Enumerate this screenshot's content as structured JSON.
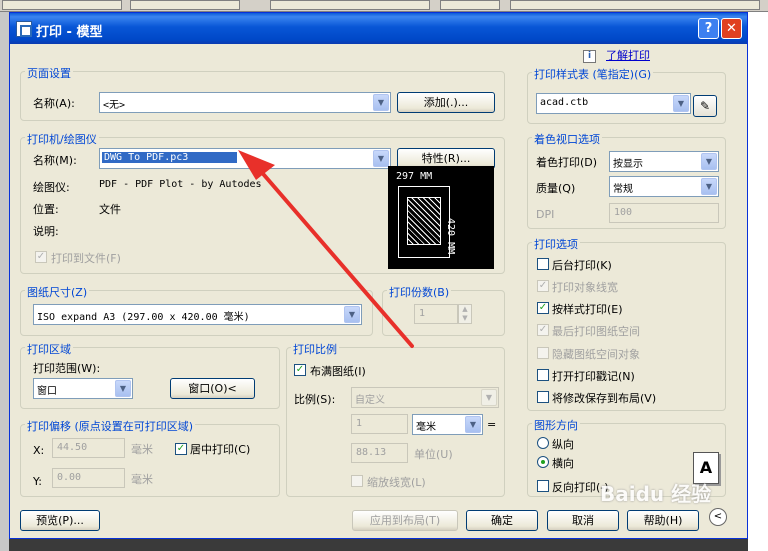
{
  "window": {
    "title": "打印 - 模型",
    "help_btn": "?",
    "close_btn": "✕"
  },
  "info": {
    "link": "了解打印"
  },
  "page_setup": {
    "group": "页面设置",
    "name_label": "名称(A):",
    "name_value": "<无>",
    "add_btn": "添加(.)..."
  },
  "printer": {
    "group": "打印机/绘图仪",
    "name_label": "名称(M):",
    "name_value": "DWG To PDF.pc3",
    "props_btn": "特性(R)...",
    "plotter_label": "绘图仪:",
    "plotter_value": "PDF - PDF Plot - by Autodes",
    "location_label": "位置:",
    "location_value": "文件",
    "desc_label": "说明:",
    "print_to_file": "打印到文件(F)",
    "preview_width": "297 MM",
    "preview_height": "420 MM"
  },
  "paper_size": {
    "group": "图纸尺寸(Z)",
    "value": "ISO expand A3 (297.00 x 420.00 毫米)"
  },
  "copies": {
    "group": "打印份数(B)",
    "value": "1"
  },
  "plot_area": {
    "group": "打印区域",
    "range_label": "打印范围(W):",
    "range_value": "窗口",
    "window_btn": "窗口(O)<"
  },
  "plot_offset": {
    "group": "打印偏移 (原点设置在可打印区域)",
    "x_label": "X:",
    "x_value": "44.50",
    "x_unit": "毫米",
    "y_label": "Y:",
    "y_value": "0.00",
    "y_unit": "毫米",
    "center_label": "居中打印(C)"
  },
  "plot_scale": {
    "group": "打印比例",
    "fit_label": "布满图纸(I)",
    "scale_label": "比例(S):",
    "scale_value": "自定义",
    "num_value": "1",
    "unit_value": "毫米",
    "equals": "=",
    "den_value": "88.13",
    "den_unit": "单位(U)",
    "lineweight_label": "缩放线宽(L)"
  },
  "style_table": {
    "group": "打印样式表 (笔指定)(G)",
    "value": "acad.ctb"
  },
  "shaded": {
    "group": "着色视口选项",
    "shade_label": "着色打印(D)",
    "shade_value": "按显示",
    "quality_label": "质量(Q)",
    "quality_value": "常规",
    "dpi_label": "DPI",
    "dpi_value": "100"
  },
  "options": {
    "group": "打印选项",
    "items": [
      {
        "label": "后台打印(K)"
      },
      {
        "label": "打印对象线宽"
      },
      {
        "label": "按样式打印(E)"
      },
      {
        "label": "最后打印图纸空间"
      },
      {
        "label": "隐藏图纸空间对象"
      },
      {
        "label": "打开打印戳记(N)"
      },
      {
        "label": "将修改保存到布局(V)"
      }
    ]
  },
  "orientation": {
    "group": "图形方向",
    "portrait": "纵向",
    "landscape": "横向",
    "reverse": "反向打印(-)",
    "icon": "A"
  },
  "buttons": {
    "preview": "预览(P)...",
    "apply": "应用到布局(T)",
    "ok": "确定",
    "cancel": "取消",
    "help": "帮助(H)",
    "expand": "<"
  },
  "watermark": "Baidu 经验"
}
